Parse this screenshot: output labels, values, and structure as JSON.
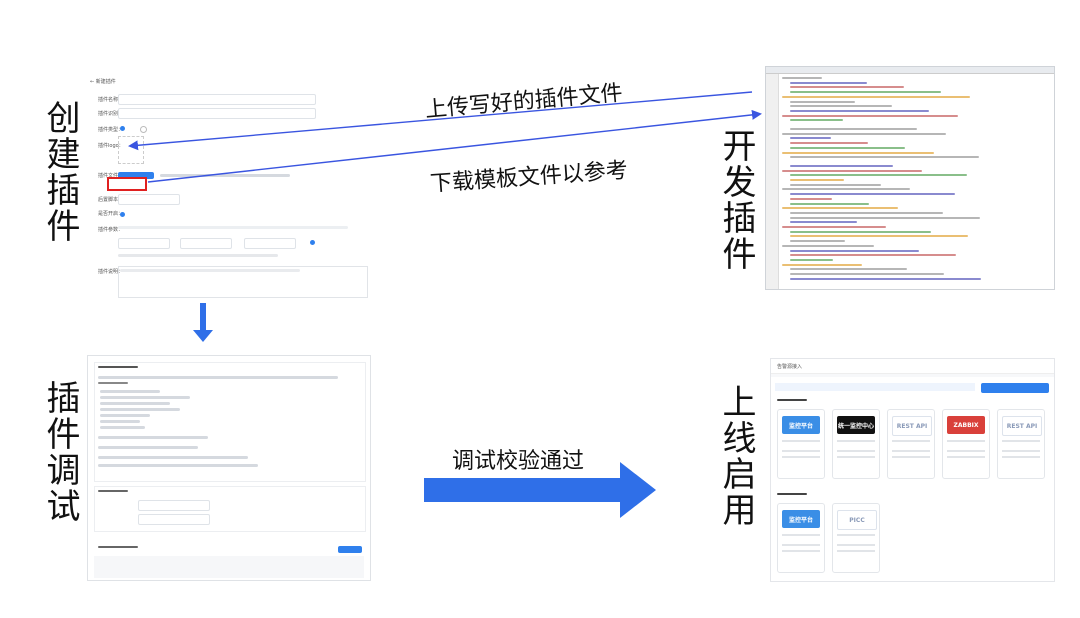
{
  "labels": {
    "create_plugin": "创建插件",
    "develop_plugin": "开发插件",
    "debug_plugin": "插件调试",
    "go_live": "上线启用"
  },
  "arrows": {
    "upload": "上传写好的插件文件",
    "download": "下载模板文件以参考",
    "verify": "调试校验通过"
  },
  "colors": {
    "thin_arrow": "#3a55e0",
    "thick_arrow": "#2f6fe8",
    "highlight_box": "#e02020"
  },
  "live_screen": {
    "cards_row1": [
      {
        "logo_text": "监控平台",
        "color": "#3a8ee6"
      },
      {
        "logo_text": "统一监控中心",
        "color": "#111111"
      },
      {
        "logo_text": "REST API",
        "color": "#ffffff"
      },
      {
        "logo_text": "ZABBIX",
        "color": "#d9403a"
      },
      {
        "logo_text": "REST API",
        "color": "#ffffff"
      }
    ],
    "cards_row2": [
      {
        "logo_text": "监控平台",
        "color": "#3a8ee6"
      },
      {
        "logo_text": "PICC",
        "color": "#ffffff"
      }
    ]
  }
}
